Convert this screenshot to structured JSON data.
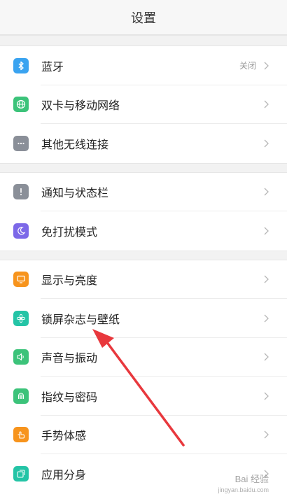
{
  "header": {
    "title": "设置"
  },
  "groups": [
    {
      "items": [
        {
          "label": "蓝牙",
          "value": "关闭",
          "icon": "bluetooth-icon",
          "color": "#3aa3f0"
        },
        {
          "label": "双卡与移动网络",
          "icon": "globe-icon",
          "color": "#3cc37a"
        },
        {
          "label": "其他无线连接",
          "icon": "more-dots-icon",
          "color": "#8a8f98"
        }
      ]
    },
    {
      "items": [
        {
          "label": "通知与状态栏",
          "icon": "exclamation-icon",
          "color": "#8a8f98"
        },
        {
          "label": "免打扰模式",
          "icon": "moon-icon",
          "color": "#7c68e8"
        }
      ]
    },
    {
      "items": [
        {
          "label": "显示与亮度",
          "icon": "monitor-icon",
          "color": "#f7941d"
        },
        {
          "label": "锁屏杂志与壁纸",
          "icon": "flower-icon",
          "color": "#24c4a6"
        },
        {
          "label": "声音与振动",
          "icon": "speaker-icon",
          "color": "#3cc37a"
        },
        {
          "label": "指纹与密码",
          "icon": "fingerprint-icon",
          "color": "#3cc37a"
        },
        {
          "label": "手势体感",
          "icon": "hand-icon",
          "color": "#f7941d"
        },
        {
          "label": "应用分身",
          "icon": "app-clone-icon",
          "color": "#24c4a6"
        }
      ]
    }
  ],
  "annotation": {
    "color": "#e8383d"
  },
  "watermark": {
    "text": "Bai 经验",
    "sub": "jingyan.baidu.com"
  }
}
